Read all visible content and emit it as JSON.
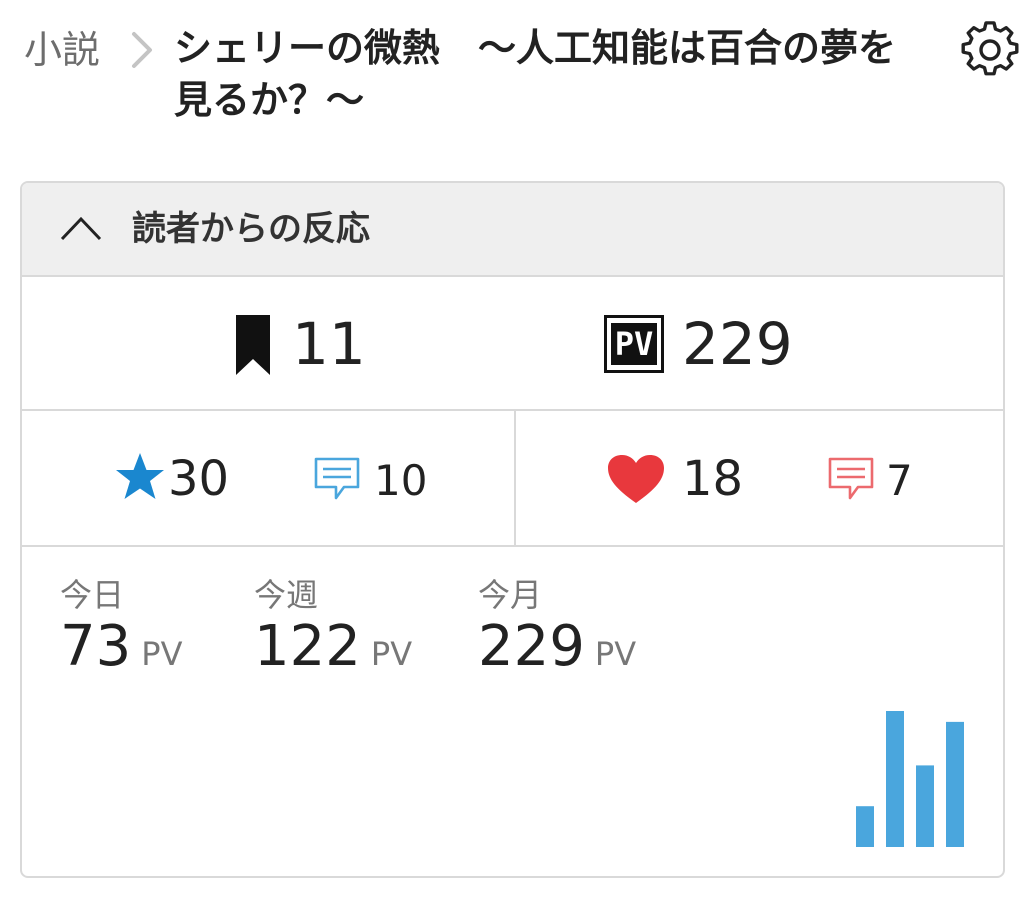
{
  "breadcrumb": {
    "category": "小説"
  },
  "title": "シェリーの微熱　～人工知能は百合の夢を見るか？～",
  "panel": {
    "heading": "読者からの反応",
    "bookmarks": "11",
    "pv_total": "229",
    "pv_icon_text": "PV",
    "stars": "30",
    "star_comments": "10",
    "hearts": "18",
    "heart_comments": "7"
  },
  "pv_stats": {
    "today_label": "今日",
    "today_value": "73",
    "week_label": "今週",
    "week_value": "122",
    "month_label": "今月",
    "month_value": "229",
    "unit": "PV"
  },
  "chart_data": {
    "type": "bar",
    "values": [
      30,
      100,
      60,
      92
    ],
    "color": "#4aa6dd"
  },
  "colors": {
    "star": "#1a87cf",
    "star_comment": "#4aa6dd",
    "heart": "#e8383d",
    "heart_comment": "#ec6a6e",
    "header_bg": "#efefef",
    "border": "#d9d9d9"
  },
  "icons": [
    "chevron-right-icon",
    "gear-icon",
    "chevron-up-icon",
    "bookmark-icon",
    "pv-icon",
    "star-icon",
    "comment-icon",
    "heart-icon"
  ]
}
